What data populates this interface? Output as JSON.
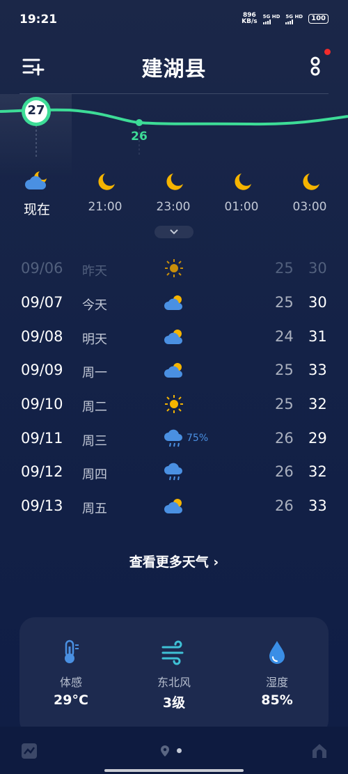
{
  "status": {
    "time": "19:21",
    "netspeed_value": "896",
    "netspeed_unit": "KB/s",
    "sim1": "5G HD",
    "sim2": "5G HD",
    "battery": "100"
  },
  "header": {
    "city": "建湖县"
  },
  "hourly": {
    "current_temp": "27",
    "low_temp": "26",
    "items": [
      {
        "label": "现在",
        "icon": "cloudy-moon-icon"
      },
      {
        "label": "21:00",
        "icon": "moon-icon"
      },
      {
        "label": "23:00",
        "icon": "moon-icon"
      },
      {
        "label": "01:00",
        "icon": "moon-icon"
      },
      {
        "label": "03:00",
        "icon": "moon-icon"
      }
    ]
  },
  "daily": [
    {
      "date": "09/06",
      "weekday": "昨天",
      "icon": "sun-icon",
      "low": "25",
      "high": "30"
    },
    {
      "date": "09/07",
      "weekday": "今天",
      "icon": "partly-cloudy-icon",
      "low": "25",
      "high": "30"
    },
    {
      "date": "09/08",
      "weekday": "明天",
      "icon": "partly-cloudy-icon",
      "low": "24",
      "high": "31"
    },
    {
      "date": "09/09",
      "weekday": "周一",
      "icon": "partly-cloudy-icon",
      "low": "25",
      "high": "33"
    },
    {
      "date": "09/10",
      "weekday": "周二",
      "icon": "sun-icon",
      "low": "25",
      "high": "32"
    },
    {
      "date": "09/11",
      "weekday": "周三",
      "icon": "rain-icon",
      "precip": "75%",
      "low": "26",
      "high": "29"
    },
    {
      "date": "09/12",
      "weekday": "周四",
      "icon": "rain-icon",
      "low": "26",
      "high": "32"
    },
    {
      "date": "09/13",
      "weekday": "周五",
      "icon": "partly-cloudy-icon",
      "low": "26",
      "high": "33"
    }
  ],
  "more_weather": "查看更多天气 ›",
  "details": {
    "feels_label": "体感",
    "feels_value": "29°C",
    "wind_label": "东北风",
    "wind_value": "3级",
    "humidity_label": "湿度",
    "humidity_value": "85%"
  },
  "colors": {
    "accent_green": "#3ddc97",
    "sun": "#f5b400",
    "rain_blue": "#4a90e2"
  }
}
